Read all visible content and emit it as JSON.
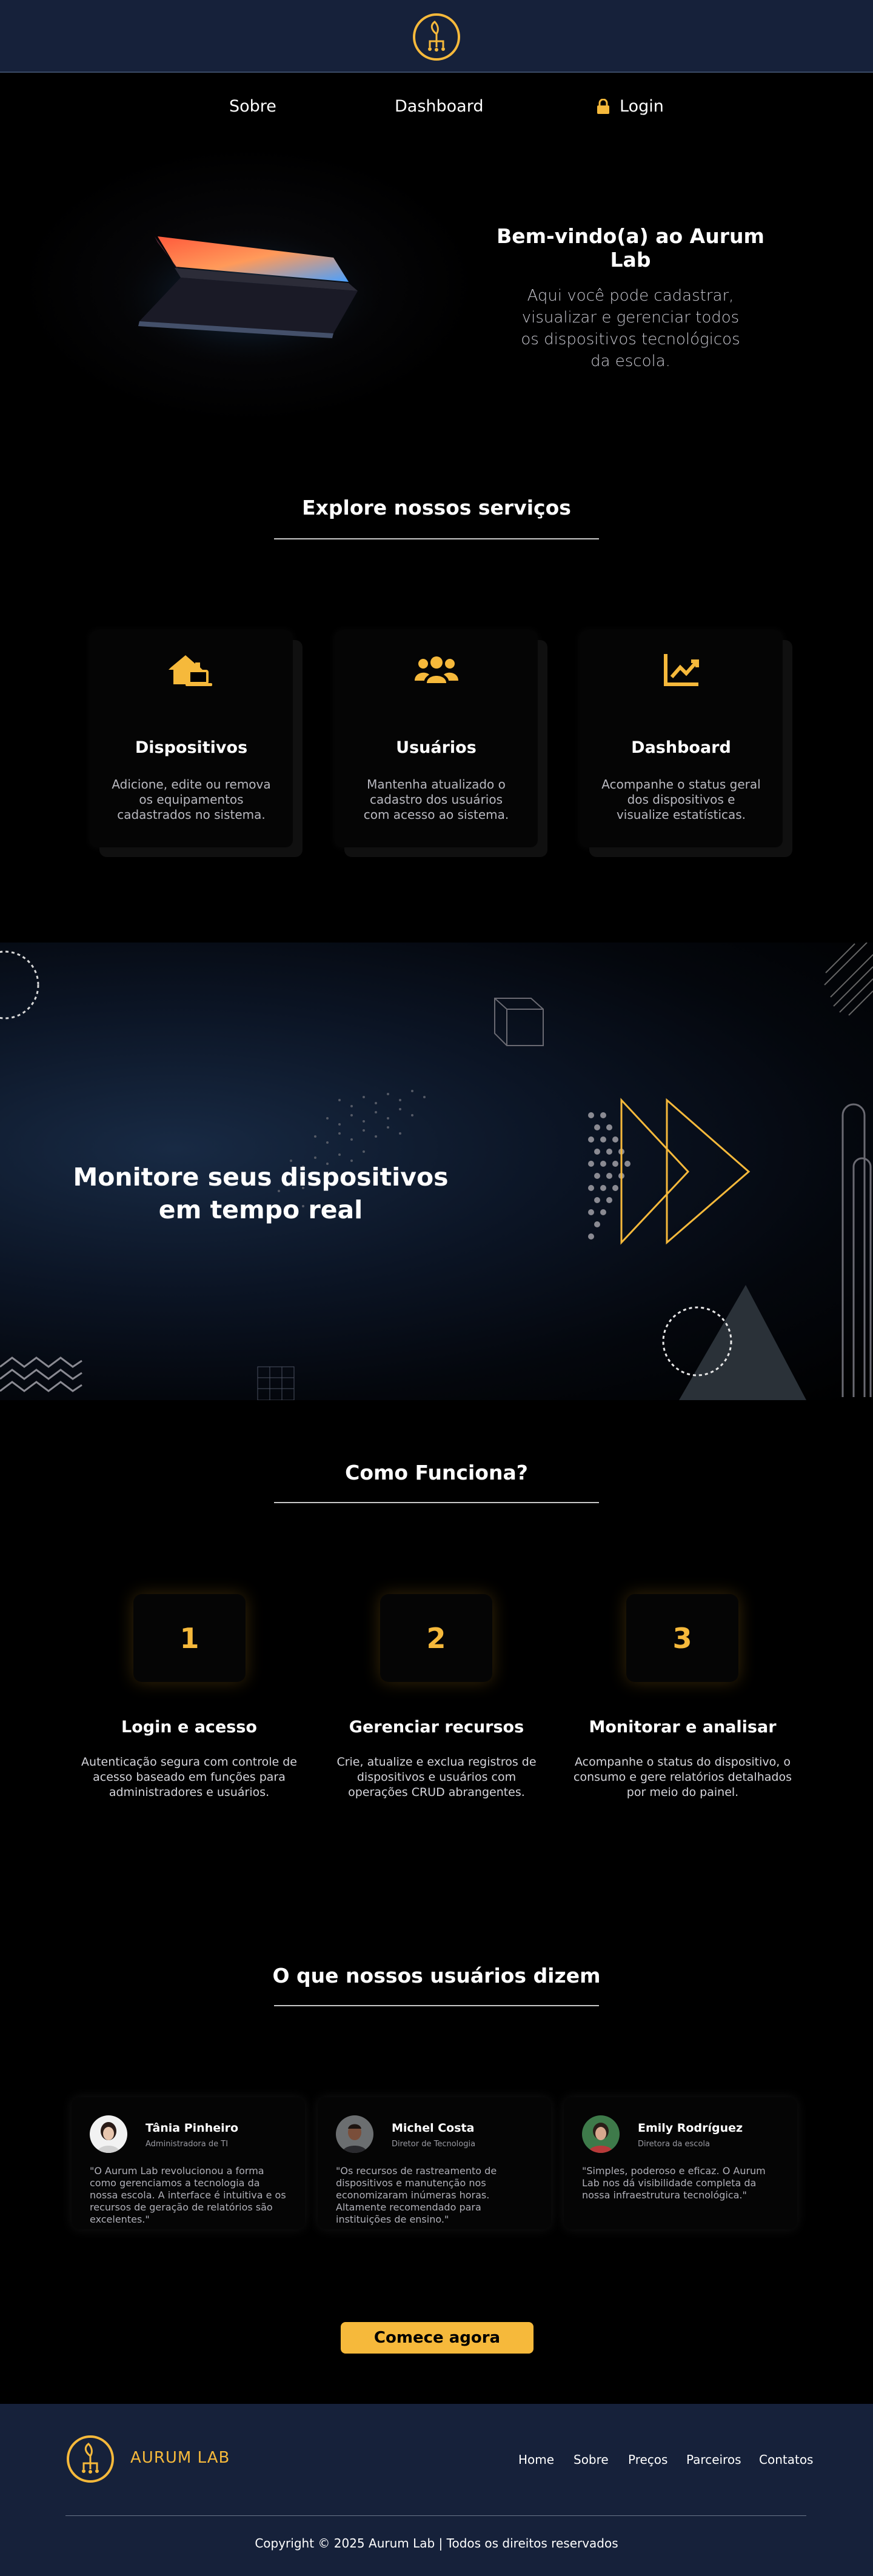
{
  "nav": {
    "sobre": "Sobre",
    "dashboard": "Dashboard",
    "login": "Login"
  },
  "hero": {
    "title": "Bem-vindo(a) ao Aurum Lab",
    "text": "Aqui você pode cadastrar, visualizar e gerenciar todos os dispositivos tecnológicos da escola."
  },
  "services": {
    "title": "Explore nossos serviços",
    "items": [
      {
        "icon": "devices-icon",
        "title": "Dispositivos",
        "text": "Adicione, edite ou remova os equipamentos cadastrados no sistema."
      },
      {
        "icon": "users-icon",
        "title": "Usuários",
        "text": "Mantenha atualizado o cadastro dos usuários com acesso ao sistema."
      },
      {
        "icon": "chart-line-icon",
        "title": "Dashboard",
        "text": "Acompanhe o status geral dos dispositivos e visualize estatísticas."
      }
    ]
  },
  "band": {
    "title": "Monitore seus dispositivos em tempo real"
  },
  "how": {
    "title": "Como Funciona?",
    "steps": [
      {
        "num": "1",
        "title": "Login e acesso",
        "text": "Autenticação segura com controle de acesso baseado em funções para administradores e usuários."
      },
      {
        "num": "2",
        "title": "Gerenciar recursos",
        "text": "Crie, atualize e exclua registros de dispositivos e usuários com operações CRUD abrangentes."
      },
      {
        "num": "3",
        "title": "Monitorar e analisar",
        "text": "Acompanhe o status do dispositivo, o consumo e gere relatórios detalhados por meio do painel."
      }
    ]
  },
  "testimonials": {
    "title": "O que nossos usuários dizem",
    "items": [
      {
        "name": "Tânia Pinheiro",
        "role": "Administradora de TI",
        "quote": "\"O Aurum Lab revolucionou a forma como gerenciamos a tecnologia da nossa escola. A interface é intuitiva e os recursos de geração de relatórios são excelentes.\""
      },
      {
        "name": "Michel Costa",
        "role": "Diretor de Tecnologia",
        "quote": "\"Os recursos de rastreamento de dispositivos e manutenção nos economizaram inúmeras horas. Altamente recomendado para instituições de ensino.\""
      },
      {
        "name": "Emily Rodríguez",
        "role": "Diretora da escola",
        "quote": "\"Simples, poderoso e eficaz. O Aurum Lab nos dá visibilidade completa da nossa infraestrutura tecnológica.\""
      }
    ]
  },
  "cta": {
    "label": "Comece agora"
  },
  "footer": {
    "brand": "AURUM LAB",
    "links": [
      "Home",
      "Sobre",
      "Preços",
      "Parceiros",
      "Contatos"
    ],
    "copyright": "Copyright © 2025 Aurum Lab | Todos os direitos reservados"
  },
  "colors": {
    "accent": "#f6b93b",
    "header_bg": "#16213a",
    "page_bg": "#000000"
  }
}
